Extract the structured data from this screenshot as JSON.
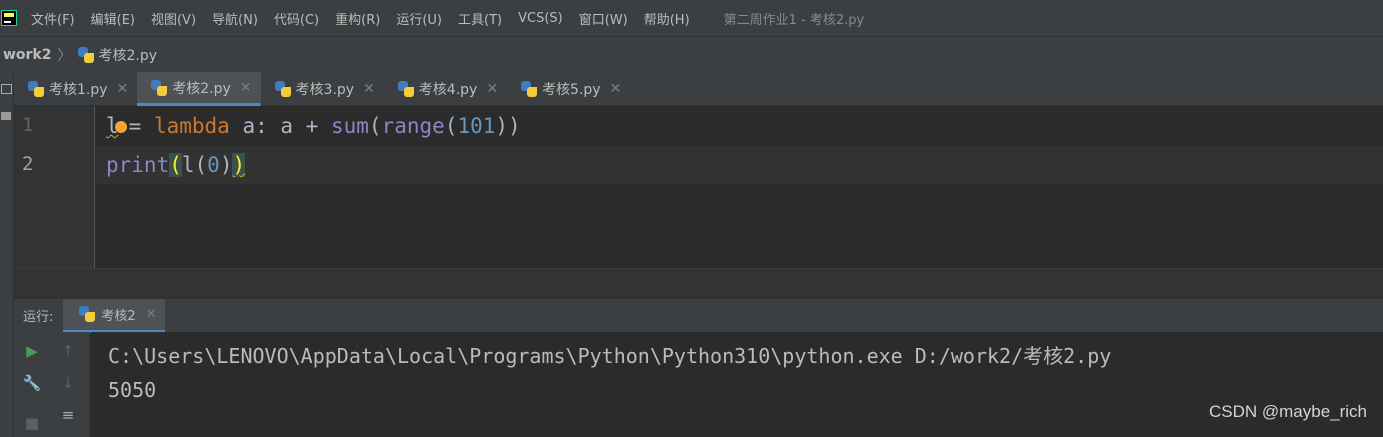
{
  "menubar": {
    "items": [
      "文件(F)",
      "编辑(E)",
      "视图(V)",
      "导航(N)",
      "代码(C)",
      "重构(R)",
      "运行(U)",
      "工具(T)",
      "VCS(S)",
      "窗口(W)",
      "帮助(H)"
    ],
    "window_title": "第二周作业1 - 考核2.py"
  },
  "breadcrumb": {
    "root": "work2",
    "file": "考核2.py"
  },
  "tabs": [
    {
      "label": "考核1.py",
      "active": false
    },
    {
      "label": "考核2.py",
      "active": true
    },
    {
      "label": "考核3.py",
      "active": false
    },
    {
      "label": "考核4.py",
      "active": false
    },
    {
      "label": "考核5.py",
      "active": false
    }
  ],
  "editor": {
    "line_numbers": [
      "1",
      "2"
    ],
    "line1": {
      "var": "l",
      "eq": "= ",
      "kw": "lambda",
      "rest1": " a: a + ",
      "sum": "sum",
      "p1": "(",
      "range": "range",
      "p2": "(",
      "num": "101",
      "p3": "))"
    },
    "line2": {
      "print": "print",
      "open": "(",
      "call": "l(",
      "num": "0",
      "close_inner": ")",
      "close": ")"
    }
  },
  "run": {
    "label": "运行:",
    "tab_label": "考核2",
    "output": [
      "C:\\Users\\LENOVO\\AppData\\Local\\Programs\\Python\\Python310\\python.exe D:/work2/考核2.py",
      "5050"
    ]
  },
  "watermark": "CSDN @maybe_rich",
  "colors": {
    "background": "#2b2b2b",
    "keyword": "#cc7832",
    "builtin": "#8888c6",
    "number": "#6897bb",
    "accent": "#4a88c7",
    "run_green": "#499c54"
  }
}
